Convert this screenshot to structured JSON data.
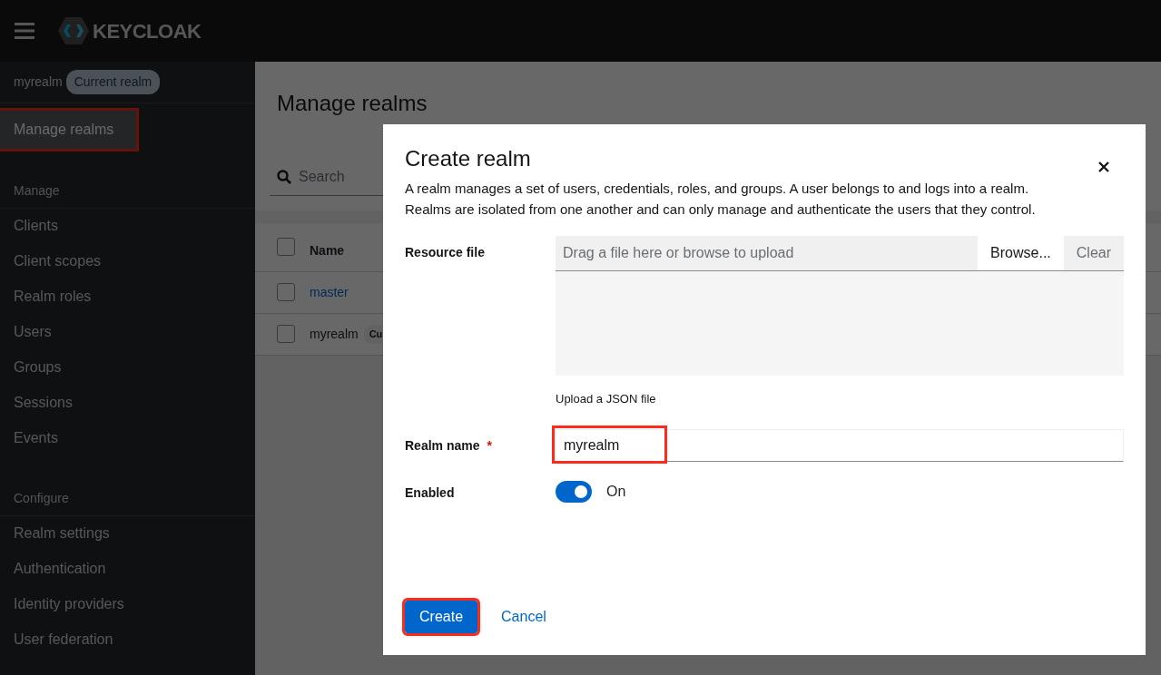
{
  "header": {
    "logo_text": "KEYCLOAK"
  },
  "sidebar": {
    "realm": {
      "name": "myrealm",
      "badge": "Current realm"
    },
    "top_item": {
      "label": "Manage realms",
      "selected": true,
      "highlighted": true
    },
    "sections": [
      {
        "title": "Manage",
        "items": [
          {
            "label": "Clients"
          },
          {
            "label": "Client scopes"
          },
          {
            "label": "Realm roles"
          },
          {
            "label": "Users"
          },
          {
            "label": "Groups"
          },
          {
            "label": "Sessions"
          },
          {
            "label": "Events"
          }
        ]
      },
      {
        "title": "Configure",
        "items": [
          {
            "label": "Realm settings"
          },
          {
            "label": "Authentication"
          },
          {
            "label": "Identity providers"
          },
          {
            "label": "User federation"
          }
        ]
      }
    ]
  },
  "main": {
    "title": "Manage realms",
    "search": {
      "placeholder": "Search"
    },
    "table": {
      "columns": [
        "Name"
      ],
      "header_checked": false,
      "rows": [
        {
          "name": "master",
          "kind": "link",
          "checked": false
        },
        {
          "name": "myrealm",
          "kind": "text",
          "badge": "Cu",
          "checked": false
        }
      ]
    }
  },
  "dialog": {
    "title": "Create realm",
    "description": "A realm manages a set of users, credentials, roles, and groups. A user belongs to and logs into a realm. Realms are isolated from one another and can only manage and authenticate the users that they control.",
    "resource_file": {
      "label": "Resource file",
      "placeholder": "Drag a file here or browse to upload",
      "browse": "Browse...",
      "clear": "Clear",
      "helper": "Upload a JSON file"
    },
    "realm_name": {
      "label": "Realm name",
      "required": "*",
      "value": "myrealm",
      "highlighted": true
    },
    "enabled": {
      "label": "Enabled",
      "on": true,
      "state_text": "On"
    },
    "buttons": [
      {
        "label": "Create",
        "kind": "primary",
        "highlighted": true
      },
      {
        "label": "Cancel",
        "kind": "link",
        "highlighted": false
      }
    ]
  }
}
